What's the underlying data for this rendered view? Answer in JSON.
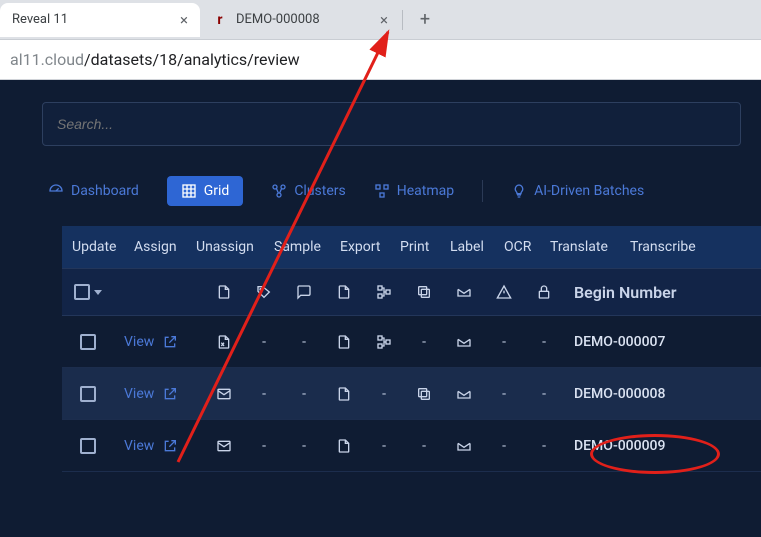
{
  "browser": {
    "tabs": [
      {
        "title": "Reveal 11",
        "active": true
      },
      {
        "title": "DEMO-000008",
        "active": false,
        "favicon": "r"
      }
    ],
    "url_muted_prefix": "al11.cloud",
    "url_path": "/datasets/18/analytics/review"
  },
  "search": {
    "placeholder": "Search..."
  },
  "view_tabs": {
    "dashboard": "Dashboard",
    "grid": "Grid",
    "clusters": "Clusters",
    "heatmap": "Heatmap",
    "ai": "AI-Driven Batches"
  },
  "actions": {
    "update": "Update",
    "assign": "Assign",
    "unassign": "Unassign",
    "sample": "Sample",
    "export": "Export",
    "print": "Print",
    "label": "Label",
    "ocr": "OCR",
    "translate": "Translate",
    "transcribe": "Transcribe"
  },
  "columns": {
    "begin_number": "Begin Number"
  },
  "rows": [
    {
      "view": "View",
      "begin": "DEMO-000007",
      "c1": "xls",
      "c2": "-",
      "c3": "-",
      "c4": "doc",
      "c5": "tree",
      "c6": "-",
      "c7": "env",
      "c8": "-",
      "c9": "-"
    },
    {
      "view": "View",
      "begin": "DEMO-000008",
      "c1": "mail",
      "c2": "-",
      "c3": "-",
      "c4": "doc",
      "c5": "-",
      "c6": "dup",
      "c7": "env",
      "c8": "-",
      "c9": "-",
      "selected": true
    },
    {
      "view": "View",
      "begin": "DEMO-000009",
      "c1": "mail",
      "c2": "-",
      "c3": "-",
      "c4": "doc",
      "c5": "-",
      "c6": "-",
      "c7": "env",
      "c8": "-",
      "c9": "-"
    }
  ]
}
